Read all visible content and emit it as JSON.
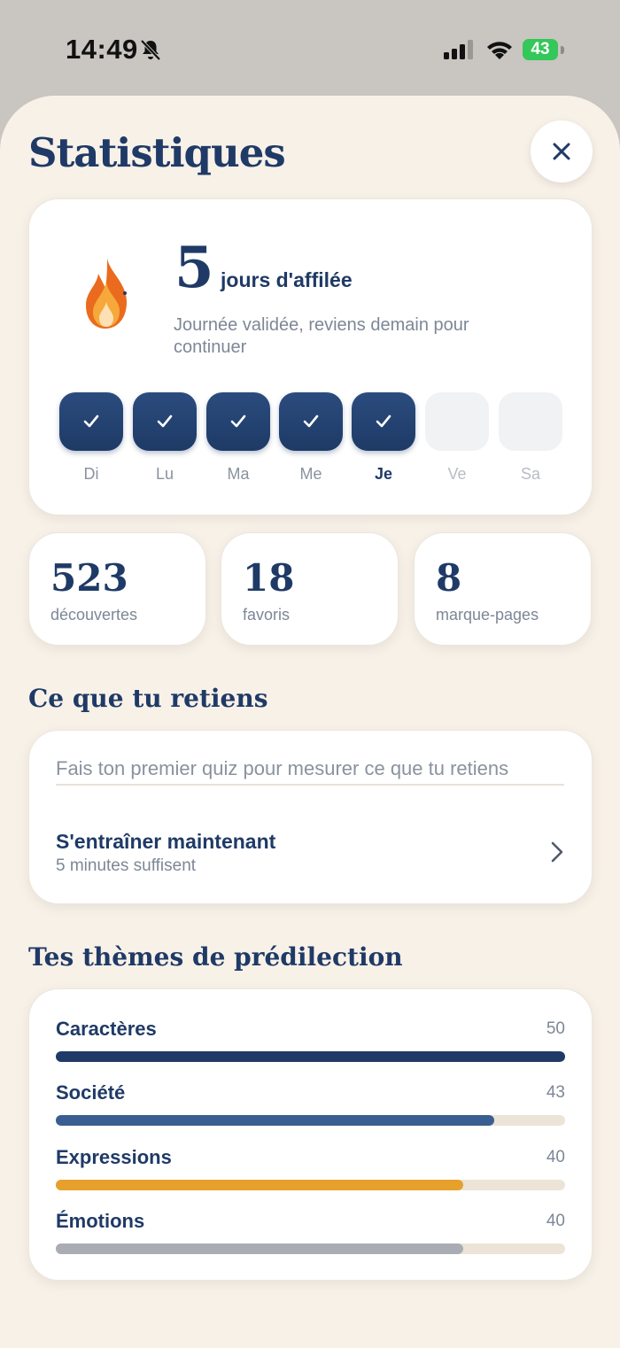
{
  "status": {
    "time": "14:49",
    "battery": "43"
  },
  "header": {
    "title": "Statistiques"
  },
  "streak": {
    "count": "5",
    "label": "jours d'affilée",
    "subtitle": "Journée validée, reviens demain pour continuer",
    "days": [
      {
        "label": "Di",
        "done": true,
        "state": "past"
      },
      {
        "label": "Lu",
        "done": true,
        "state": "past"
      },
      {
        "label": "Ma",
        "done": true,
        "state": "past"
      },
      {
        "label": "Me",
        "done": true,
        "state": "past"
      },
      {
        "label": "Je",
        "done": true,
        "state": "today"
      },
      {
        "label": "Ve",
        "done": false,
        "state": "future"
      },
      {
        "label": "Sa",
        "done": false,
        "state": "future"
      }
    ]
  },
  "stats": [
    {
      "value": "523",
      "label": "découvertes"
    },
    {
      "value": "18",
      "label": "favoris"
    },
    {
      "value": "8",
      "label": "marque-pages"
    }
  ],
  "retention": {
    "section_title": "Ce que tu retiens",
    "placeholder": "Fais ton premier quiz pour mesurer ce que tu retiens",
    "action_title": "S'entraîner maintenant",
    "action_subtitle": "5 minutes suffisent"
  },
  "themes": {
    "section_title": "Tes thèmes de prédilection",
    "items": [
      {
        "name": "Caractères",
        "value": "50",
        "fraction": 1.0,
        "color": "#1f3a66"
      },
      {
        "name": "Société",
        "value": "43",
        "fraction": 0.86,
        "color": "#3a5e91"
      },
      {
        "name": "Expressions",
        "value": "40",
        "fraction": 0.8,
        "color": "#e6a02c"
      },
      {
        "name": "Émotions",
        "value": "40",
        "fraction": 0.8,
        "color": "#a9adb3"
      }
    ]
  }
}
